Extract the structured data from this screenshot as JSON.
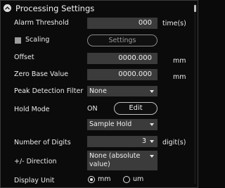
{
  "section": {
    "title": "Processing Settings"
  },
  "alarm_threshold": {
    "label": "Alarm Threshold",
    "value": "000",
    "unit": "time(s)"
  },
  "scaling": {
    "label": "Scaling",
    "checked": false,
    "settings_button": "Settings"
  },
  "offset": {
    "label": "Offset",
    "value": "0000.000",
    "unit": "mm"
  },
  "zero_base": {
    "label": "Zero Base Value",
    "value": "0000.000",
    "unit": "mm"
  },
  "peak_filter": {
    "label": "Peak Detection Filter",
    "selected": "None"
  },
  "hold_mode": {
    "label": "Hold Mode",
    "state": "ON",
    "edit_button": "Edit",
    "selected": "Sample Hold"
  },
  "digits": {
    "label": "Number of Digits",
    "selected": "3",
    "unit": "digit(s)"
  },
  "direction": {
    "label": "+/- Direction",
    "selected_line1": "None (absolute",
    "selected_line2": "value)"
  },
  "display_unit": {
    "label": "Display Unit",
    "options": [
      "mm",
      "um"
    ],
    "selected": "mm"
  }
}
